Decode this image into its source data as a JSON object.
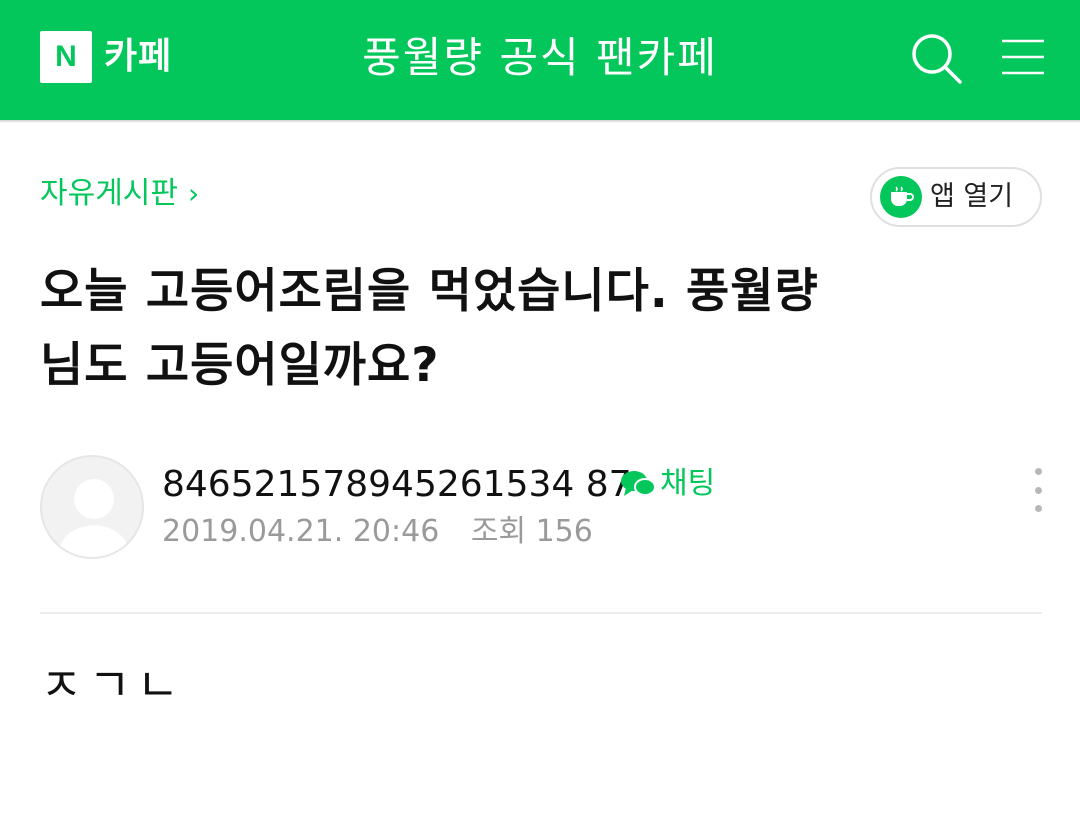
{
  "header": {
    "logo_letter": "N",
    "logo_text": "카페",
    "cafe_title": "풍월량 공식 팬카페",
    "search_icon": "search-icon",
    "menu_icon": "menu-icon",
    "bar_color": "#03c75a"
  },
  "board": {
    "name": "자유게시판",
    "chevron": "›"
  },
  "app_open": {
    "label": "앱 열기",
    "icon": "cafe-cup-icon"
  },
  "post": {
    "title": "오늘 고등어조림을 먹었습니다. 풍월량\n님도 고등어일까요?",
    "author": "846521578945261534 87",
    "chat_label": "채팅",
    "date": "2019.04.21. 20:46",
    "views": "조회 156",
    "body": "ㅈㄱㄴ"
  },
  "colors": {
    "accent": "#03c75a",
    "meta_text": "#9a9a9a"
  }
}
